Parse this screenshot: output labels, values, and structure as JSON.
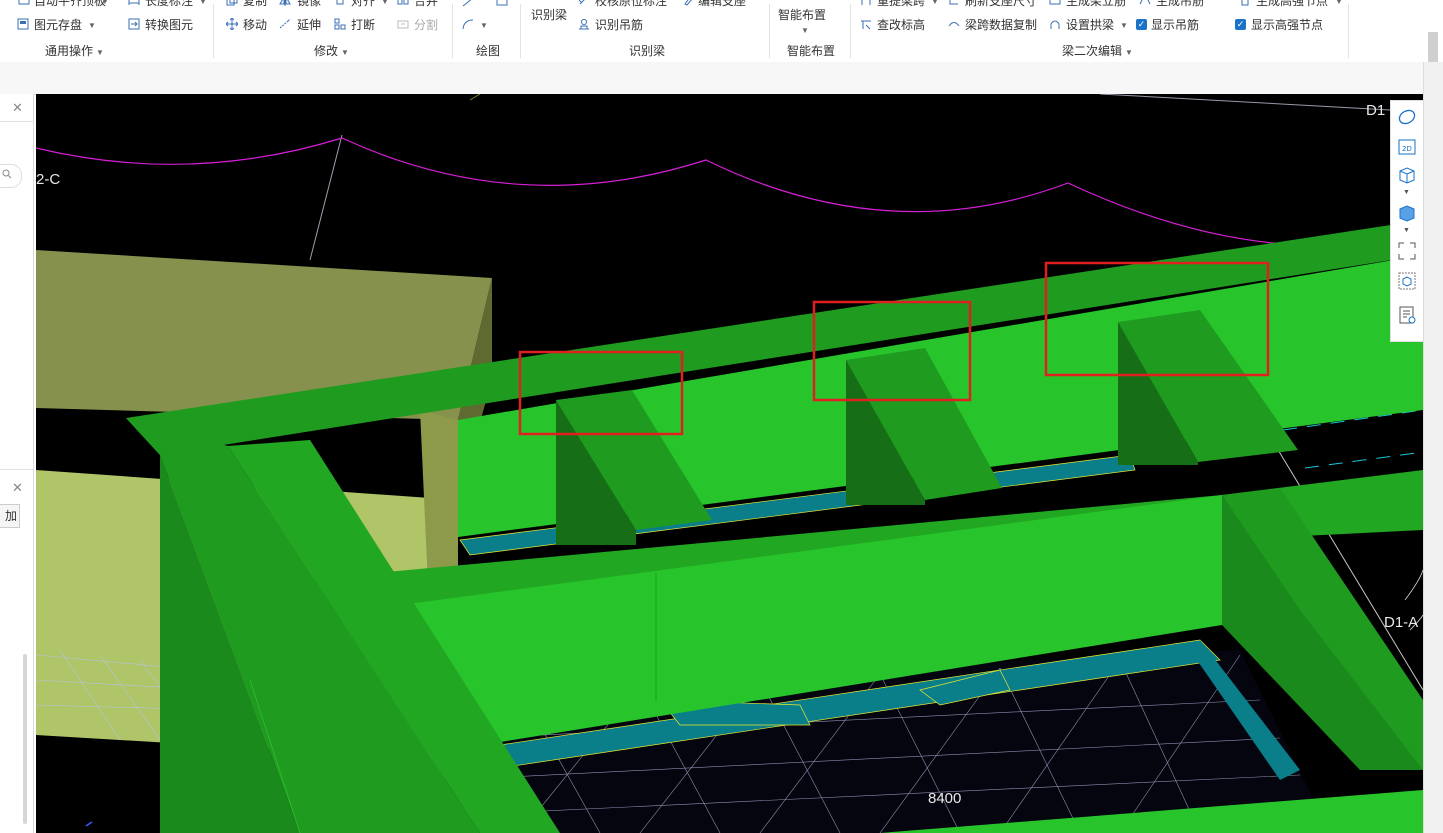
{
  "ribbon": {
    "groups": {
      "general_ops": "通用操作",
      "modify": "修改",
      "draw": "绘图",
      "identify_beam": "识别梁",
      "smart_layout": "智能布置",
      "beam_secondary_edit": "梁二次编辑"
    },
    "general": {
      "auto_flat_slab": "自动平齐顶板",
      "length_label": "长度标注",
      "element_save": "图元存盘",
      "convert_element": "转换图元"
    },
    "modify": {
      "copy": "复制",
      "mirror": "镜像",
      "align": "对齐",
      "merge": "合并",
      "move": "移动",
      "extend": "延伸",
      "break": "打断",
      "split": "分割"
    },
    "identify": {
      "identify_beam": "识别梁",
      "check_origin_label": "校核原位标注",
      "edit_support": "编辑支座",
      "identify_hanger": "识别吊筋"
    },
    "smart": {
      "smart_layout": "智能布置"
    },
    "beam_edit": {
      "redo_span": "重提梁跨",
      "refresh_support_size": "刷新支座尺寸",
      "gen_beam_stirrup": "生成架立筋",
      "gen_hanger": "生成吊筋",
      "gen_high_strength_node": "生成高强节点",
      "check_elevation": "查改标高",
      "span_data_copy": "梁跨数据复制",
      "set_arch_beam": "设置拱梁",
      "show_hanger": "显示吊筋",
      "show_high_strength_node": "显示高强节点"
    }
  },
  "left_panel": {
    "add_button": "加"
  },
  "viewport": {
    "axis_labels": {
      "top_right": "D1",
      "left_top": "2-C",
      "right_mid": "D1-A",
      "dimension": "8400"
    },
    "colors": {
      "background": "#000000",
      "beam_light": "#27c52b",
      "beam_mid": "#22a722",
      "beam_dark": "#1a8a1c",
      "beam_darker": "#157015",
      "slab_olive": "#85914c",
      "slab_light": "#b0c468",
      "slab_teal": "#0a7f8a",
      "arc_magenta": "#d61fd6",
      "highlight_red": "#e02020",
      "grid_line": "#aab4d4"
    }
  }
}
